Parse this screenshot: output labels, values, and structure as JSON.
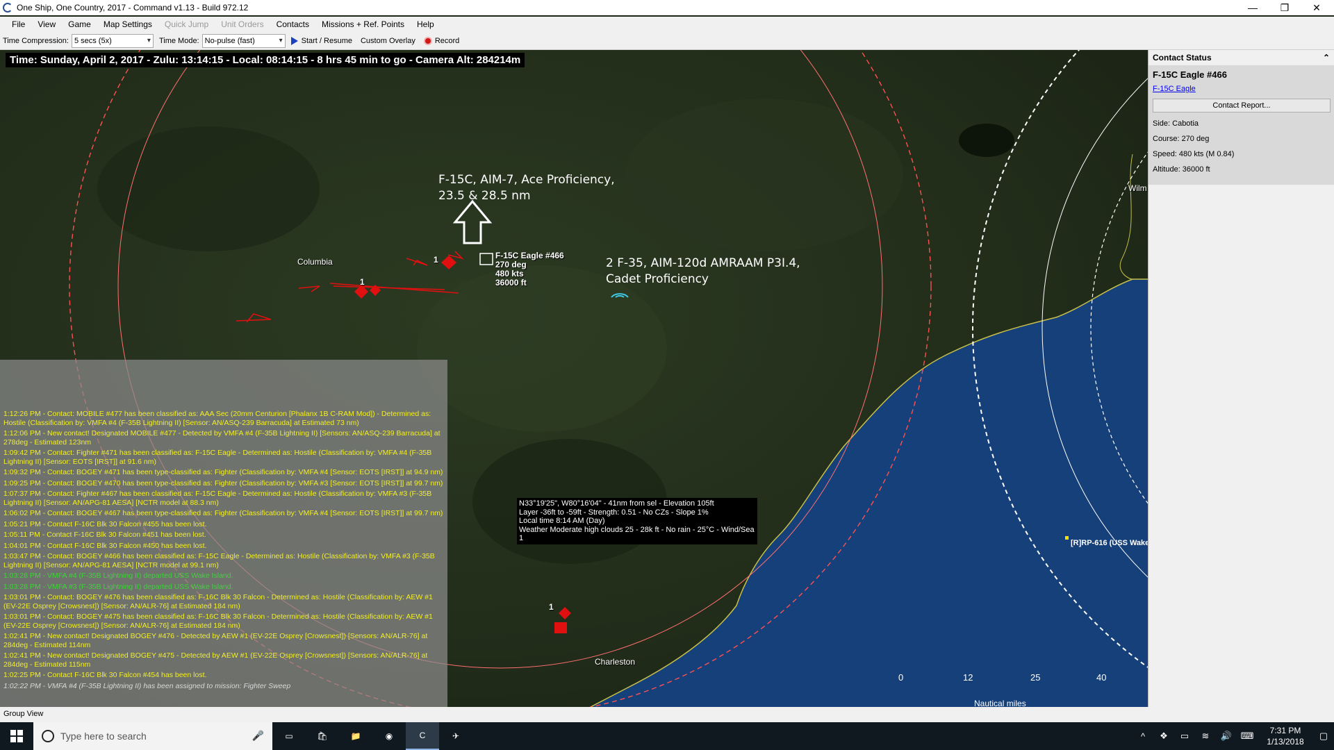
{
  "window": {
    "title": "One Ship, One Country, 2017 - Command v1.13 - Build 972.12",
    "controls": [
      "—",
      "❐",
      "✕"
    ]
  },
  "menu": [
    "File",
    "View",
    "Game",
    "Map Settings",
    "Quick Jump",
    "Unit Orders",
    "Contacts",
    "Missions + Ref. Points",
    "Help"
  ],
  "menu_disabled": [
    "Quick Jump",
    "Unit Orders"
  ],
  "toolbar": {
    "time_compression_label": "Time Compression:",
    "time_compression_value": "5 secs (5x)",
    "time_mode_label": "Time Mode:",
    "time_mode_value": "No-pulse (fast)",
    "start_label": "Start / Resume",
    "overlay_label": "Custom Overlay",
    "record_label": "Record"
  },
  "map": {
    "time_bar": "Time: Sunday, April 2, 2017 - Zulu: 13:14:15 - Local: 08:14:15 - 8 hrs 45 min to go -  Camera Alt: 284214m",
    "annotation_1": [
      "F-15C, AIM-7, Ace Proficiency,",
      "23.5 & 28.5 nm"
    ],
    "annotation_2": [
      "2 F-35, AIM-120d AMRAAM P3I.4,",
      "Cadet Proficiency"
    ],
    "cities": {
      "columbia": "Columbia",
      "charleston": "Charleston",
      "wilmington": "Wilm"
    },
    "selected_unit": {
      "name": "F-15C Eagle #466",
      "course": "270 deg",
      "speed": "480 kts",
      "altitude": "36000 ft"
    },
    "group_counts": [
      "1",
      "1",
      "1"
    ],
    "ref_point": "[R]RP-616 (USS Wake",
    "info_box": [
      "N33°19'25\", W80°16'04\" - 41nm from sel - Elevation 105ft",
      "Layer -36ft to -59ft - Strength: 0.51 - No CZs - Slope 1%",
      "Local time 8:14 AM (Day)",
      "Weather Moderate high clouds 25 - 28k ft - No rain - 25°C - Wind/Sea 1"
    ],
    "scale_ticks": [
      "0",
      "12",
      "25",
      "40"
    ],
    "scale_unit": "Nautical miles"
  },
  "log": [
    {
      "text": "1:12:26 PM - Contact: MOBILE #477 has been classified as: AAA Sec (20mm Centurion [Phalanx 1B C-RAM Mod]) - Determined as: Hostile (Classification by: VMFA #4 (F-35B Lightning II) [Sensor: AN/ASQ-239 Barracuda] at Estimated 73 nm)",
      "type": "yellow"
    },
    {
      "text": "1:12:06 PM - New contact! Designated MOBILE #477 - Detected by VMFA #4 (F-35B Lightning II)  [Sensors: AN/ASQ-239 Barracuda] at 278deg - Estimated 123nm",
      "type": "yellow"
    },
    {
      "text": "1:09:42 PM - Contact: Fighter #471 has been classified as: F-15C Eagle - Determined as: Hostile (Classification by: VMFA #4 (F-35B Lightning II) [Sensor: EOTS [IRST]] at 91.6 nm)",
      "type": "yellow"
    },
    {
      "text": "1:09:32 PM - Contact: BOGEY #471 has been type-classified as: Fighter (Classification by: VMFA #4 [Sensor: EOTS [IRST]] at 94.9 nm)",
      "type": "yellow"
    },
    {
      "text": "1:09:25 PM - Contact: BOGEY #470 has been type-classified as: Fighter (Classification by: VMFA #3 [Sensor: EOTS [IRST]] at 99.7 nm)",
      "type": "yellow"
    },
    {
      "text": "1:07:37 PM - Contact: Fighter #467 has been classified as: F-15C Eagle - Determined as: Hostile (Classification by: VMFA #3 (F-35B Lightning II) [Sensor: AN/APG-81 AESA] [NCTR model at 88.3 nm)",
      "type": "yellow"
    },
    {
      "text": "1:06:02 PM - Contact: BOGEY #467 has been type-classified as: Fighter (Classification by: VMFA #4 [Sensor: EOTS [IRST]] at 99.7 nm)",
      "type": "yellow"
    },
    {
      "text": "1:05:21 PM - Contact F-16C Blk 30 Falcon #455 has been lost.",
      "type": "yellow"
    },
    {
      "text": "1:05:11 PM - Contact F-16C Blk 30 Falcon #451 has been lost.",
      "type": "yellow"
    },
    {
      "text": "1:04:01 PM - Contact F-16C Blk 30 Falcon #450 has been lost.",
      "type": "yellow"
    },
    {
      "text": "1:03:47 PM - Contact: BOGEY #466 has been classified as: F-15C Eagle - Determined as: Hostile (Classification by: VMFA #3 (F-35B Lightning II) [Sensor: AN/APG-81 AESA] [NCTR model at 99.1 nm)",
      "type": "yellow"
    },
    {
      "text": "1:03:28 PM - VMFA #4 (F-35B Lightning II) departed USS Wake Island.",
      "type": "green"
    },
    {
      "text": "1:03:28 PM - VMFA #3 (F-35B Lightning II) departed USS Wake Island.",
      "type": "green"
    },
    {
      "text": "1:03:01 PM - Contact: BOGEY #476 has been classified as: F-16C Blk 30 Falcon - Determined as: Hostile (Classification by: AEW #1 (EV-22E Osprey [Crowsnest]) [Sensor: AN/ALR-76] at Estimated 184 nm)",
      "type": "yellow"
    },
    {
      "text": "1:03:01 PM - Contact: BOGEY #475 has been classified as: F-16C Blk 30 Falcon - Determined as: Hostile (Classification by: AEW #1 (EV-22E Osprey [Crowsnest]) [Sensor: AN/ALR-76] at Estimated 184 nm)",
      "type": "yellow"
    },
    {
      "text": "1:02:41 PM - New contact! Designated BOGEY #476 - Detected by AEW #1 (EV-22E Osprey [Crowsnest])  [Sensors: AN/ALR-76] at 284deg - Estimated 114nm",
      "type": "yellow"
    },
    {
      "text": "1:02:41 PM - New contact! Designated BOGEY #475 - Detected by AEW #1 (EV-22E Osprey [Crowsnest])  [Sensors: AN/ALR-76] at 284deg - Estimated 115nm",
      "type": "yellow"
    },
    {
      "text": "1:02:25 PM - Contact F-16C Blk 30 Falcon #454 has been lost.",
      "type": "yellow"
    },
    {
      "text": "1:02:22 PM - VMFA #4 (F-35B Lightning II) has been assigned to mission: Fighter Sweep",
      "type": "faded"
    }
  ],
  "panel": {
    "header": "Contact Status",
    "collapse_icon": "chevron-up-icon",
    "contact_name": "F-15C Eagle #466",
    "contact_link": "F-15C Eagle",
    "report_button": "Contact Report...",
    "side": "Side: Cabotia",
    "course": "Course: 270 deg",
    "speed": "Speed: 480 kts (M 0.84)",
    "altitude": "Altitude: 36000 ft"
  },
  "statusbar": "Group View",
  "taskbar": {
    "search_placeholder": "Type here to search",
    "time": "7:31 PM",
    "date": "1/13/2018"
  },
  "colors": {
    "log_yellow": "#f2ee2a",
    "log_green": "#3ed43a",
    "hostile": "#e01010",
    "friendly": "#40c8e8",
    "ocean": "#16407a"
  }
}
